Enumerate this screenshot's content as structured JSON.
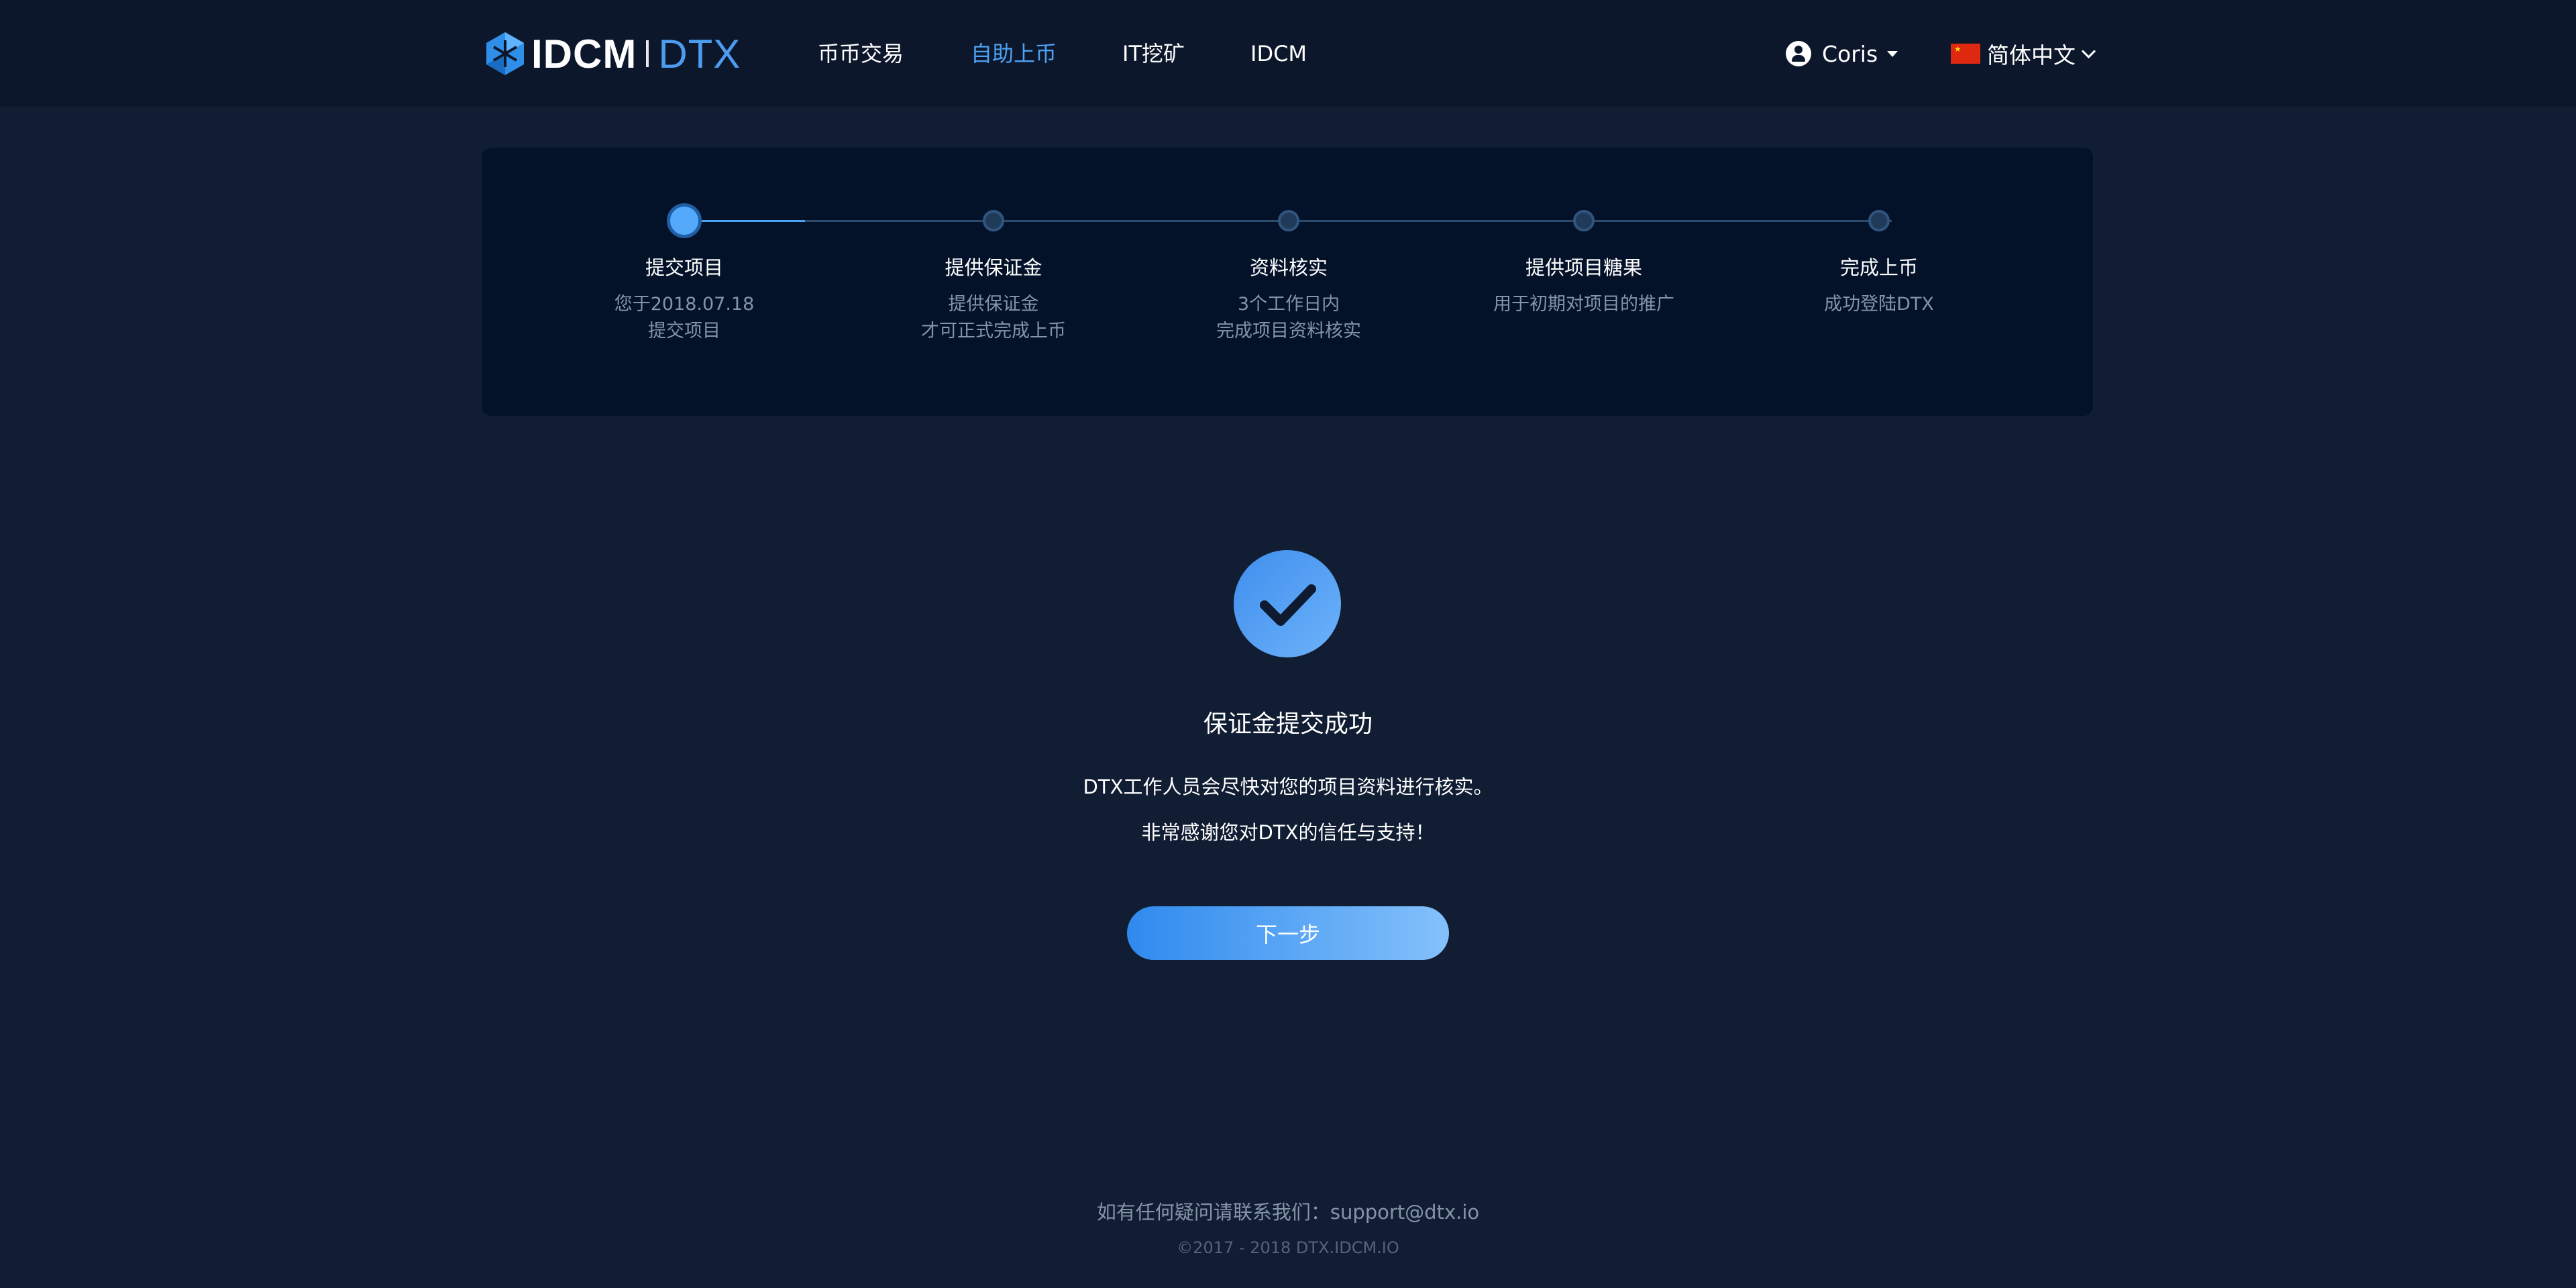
{
  "header": {
    "logo_primary": "IDCM",
    "logo_secondary": "DTX",
    "nav": [
      {
        "label": "币币交易",
        "active": false
      },
      {
        "label": "自助上币",
        "active": true
      },
      {
        "label": "IT挖矿",
        "active": false
      },
      {
        "label": "IDCM",
        "active": false
      }
    ],
    "user_name": "Coris",
    "language": "简体中文"
  },
  "steps": [
    {
      "title": "提交项目",
      "desc_line1": "您于2018.07.18",
      "desc_line2": "提交项目",
      "state": "current"
    },
    {
      "title": "提供保证金",
      "desc_line1": "提供保证金",
      "desc_line2": "才可正式完成上币",
      "state": "pending"
    },
    {
      "title": "资料核实",
      "desc_line1": "3个工作日内",
      "desc_line2": "完成项目资料核实",
      "state": "pending"
    },
    {
      "title": "提供项目糖果",
      "desc_line1": "用于初期对项目的推广",
      "desc_line2": "",
      "state": "pending"
    },
    {
      "title": "完成上币",
      "desc_line1": "成功登陆DTX",
      "desc_line2": "",
      "state": "pending"
    }
  ],
  "result": {
    "title": "保证金提交成功",
    "message_line1": "DTX工作人员会尽快对您的项目资料进行核实。",
    "message_line2": "非常感谢您对DTX的信任与支持！",
    "next_button": "下一步"
  },
  "footer": {
    "contact_prefix": "如有任何疑问请联系我们：",
    "email": "support@dtx.io",
    "copyright": "©2017 - 2018 DTX.IDCM.IO"
  },
  "colors": {
    "background": "#111d33",
    "header": "#0c172b",
    "panel": "#041229",
    "accent": "#4ea2f4"
  }
}
